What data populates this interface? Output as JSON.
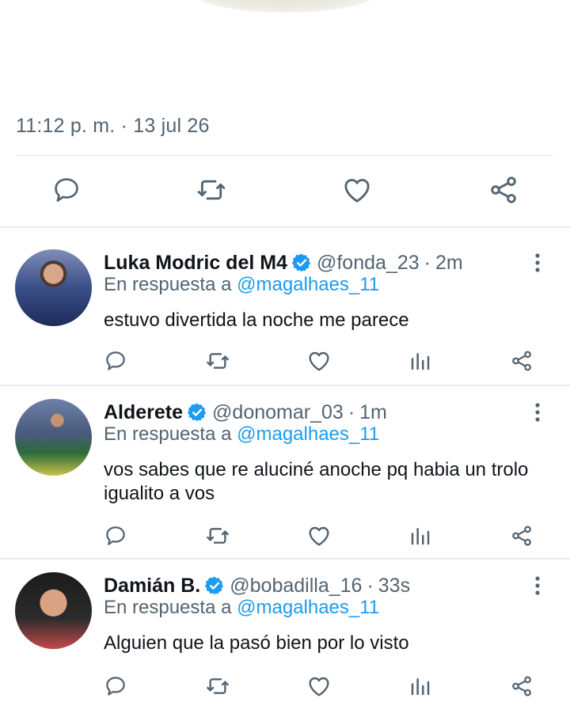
{
  "tweet": {
    "timestamp": "11:12 p. m. · 13 jul 26",
    "actions": [
      "reply-icon",
      "retweet-icon",
      "like-icon",
      "share-icon"
    ]
  },
  "replies": [
    {
      "name": "Luka Modric del M4",
      "handle": "@fonda_23",
      "dot": "·",
      "time": "2m",
      "in_reply_prefix": "En respuesta a",
      "in_reply_handle": "@magalhaes_11",
      "text": "estuvo divertida la noche me parece"
    },
    {
      "name": "Alderete",
      "handle": "@donomar_03",
      "dot": "·",
      "time": "1m",
      "in_reply_prefix": "En respuesta a",
      "in_reply_handle": "@magalhaes_11",
      "text": "vos sabes que re aluciné anoche pq habia un trolo igualito a vos"
    },
    {
      "name": "Damián B.",
      "handle": "@bobadilla_16",
      "dot": "·",
      "time": "33s",
      "in_reply_prefix": "En respuesta a",
      "in_reply_handle": "@magalhaes_11",
      "text": "Alguien que la pasó bien por lo visto"
    }
  ],
  "colors": {
    "accent": "#1d9bf0",
    "muted": "#536471",
    "text": "#0f1419"
  }
}
